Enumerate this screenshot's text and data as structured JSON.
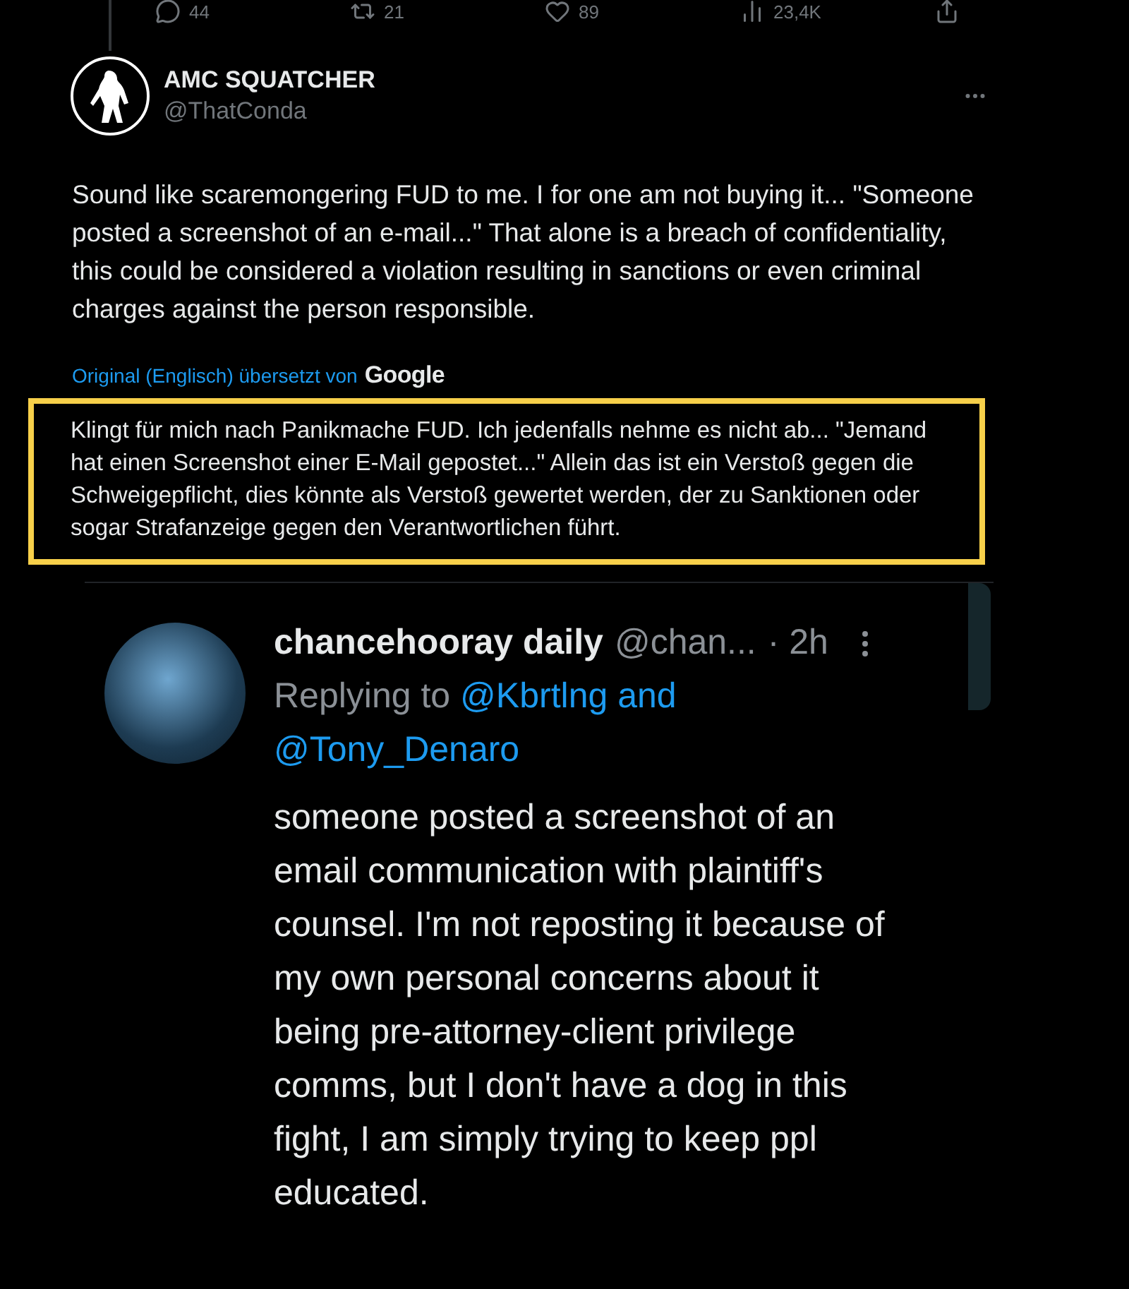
{
  "action_bar": [
    {
      "kind": "reply",
      "count": "44"
    },
    {
      "kind": "repost",
      "count": "21"
    },
    {
      "kind": "like",
      "count": "89"
    },
    {
      "kind": "views",
      "count": "23,4K"
    },
    {
      "kind": "share"
    }
  ],
  "tweet": {
    "name": "AMC SQUATCHER",
    "handle": "@ThatConda",
    "text": "Sound like scaremongering FUD to me. I for one am not buying it... \"Someone posted a screenshot of an e-mail...\" That alone is a breach of confidentiality, this could be considered a violation resulting in sanctions or even criminal charges against the person responsible.",
    "translation_label": "Original (Englisch) übersetzt von",
    "translation_provider": "Google",
    "translation": "Klingt für mich nach Panikmache FUD. Ich jedenfalls nehme es nicht ab... \"Jemand hat einen Screenshot einer E-Mail gepostet...\" Allein das ist ein Verstoß gegen die Schweigepflicht, dies könnte als Verstoß gewertet werden, der zu Sanktionen oder sogar Strafanzeige gegen den Verantwortlichen führt."
  },
  "quoted_screenshot": {
    "name": "chancehooray daily",
    "handle": "@chan...",
    "time": "· 2h",
    "replying_label": "Replying to",
    "replying_mentions": [
      "@Kbrtlng",
      "@Tony_Denaro"
    ],
    "mentions_joiner": "and",
    "text": "someone posted a screenshot of an email communication with plaintiff's counsel. I'm not reposting it because of my own personal concerns about it being pre-attorney-client privilege comms, but I don't have a dog in this fight, I am simply trying to keep ppl educated."
  }
}
